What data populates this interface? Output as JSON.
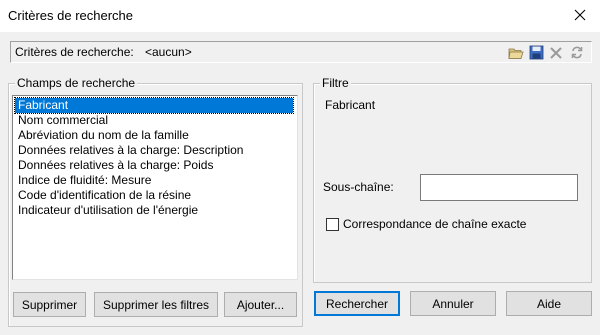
{
  "window": {
    "title": "Critères de recherche"
  },
  "criteria": {
    "label": "Critères de recherche:",
    "value": "<aucun>",
    "toolbar_icons": [
      "open-folder-icon",
      "save-icon",
      "delete-icon",
      "refresh-icon"
    ]
  },
  "fields_group": {
    "legend": "Champs de recherche",
    "items": [
      "Fabricant",
      "Nom commercial",
      "Abréviation du nom de la famille",
      "Données relatives à la charge: Description",
      "Données relatives à la charge: Poids",
      "Indice de fluidité: Mesure",
      "Code d'identification de la résine",
      "Indicateur d'utilisation de l'énergie"
    ],
    "selected_index": 0,
    "buttons": {
      "delete": "Supprimer",
      "clear_filters": "Supprimer les filtres",
      "add": "Ajouter..."
    }
  },
  "filter_group": {
    "legend": "Filtre",
    "field_title": "Fabricant",
    "substring_label": "Sous-chaîne:",
    "substring_value": "",
    "exact_match_label": "Correspondance de chaîne exacte",
    "exact_match_checked": false
  },
  "actions": {
    "search": "Rechercher",
    "cancel": "Annuler",
    "help": "Aide"
  },
  "colors": {
    "selection": "#0078d7",
    "dialog_bg": "#f0f0f0",
    "accent_blue": "#3d6cc4"
  }
}
